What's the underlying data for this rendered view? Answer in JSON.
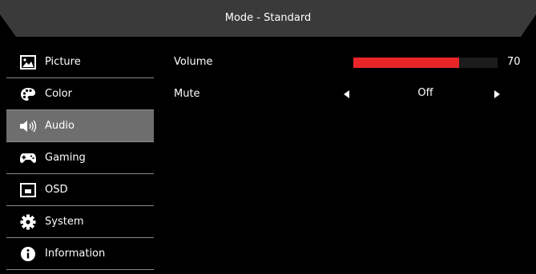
{
  "header": {
    "title": "Mode - Standard"
  },
  "sidebar": {
    "items": [
      {
        "label": "Picture",
        "icon": "picture-icon",
        "active": false
      },
      {
        "label": "Color",
        "icon": "palette-icon",
        "active": false
      },
      {
        "label": "Audio",
        "icon": "speaker-icon",
        "active": true
      },
      {
        "label": "Gaming",
        "icon": "gamepad-icon",
        "active": false
      },
      {
        "label": "OSD",
        "icon": "osd-icon",
        "active": false
      },
      {
        "label": "System",
        "icon": "gear-icon",
        "active": false
      },
      {
        "label": "Information",
        "icon": "info-icon",
        "active": false
      }
    ]
  },
  "settings": {
    "volume": {
      "label": "Volume",
      "value": "70",
      "level": 0.735
    },
    "mute": {
      "label": "Mute",
      "value": "Off"
    }
  },
  "colors": {
    "accent": "#e8262a",
    "active_item": "#6e6e6e",
    "header": "#3a3a3a"
  }
}
